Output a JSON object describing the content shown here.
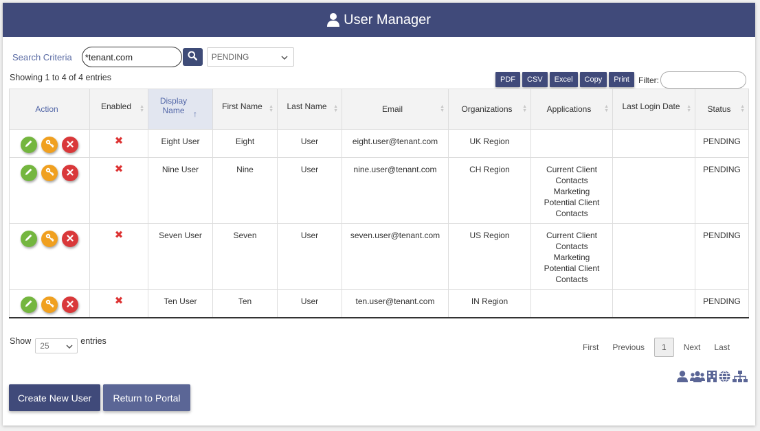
{
  "header": {
    "title": "User Manager",
    "icon": "user-icon"
  },
  "search": {
    "label": "Search Criteria",
    "value": "*tenant.com",
    "button_icon": "search-icon",
    "status_value": "PENDING"
  },
  "info": {
    "showing": "Showing 1 to 4 of 4 entries"
  },
  "export": {
    "pdf": "PDF",
    "csv": "CSV",
    "excel": "Excel",
    "copy": "Copy",
    "print": "Print"
  },
  "filter": {
    "label": "Filter:",
    "value": ""
  },
  "table": {
    "headers": {
      "action": "Action",
      "enabled": "Enabled",
      "display_name": "Display Name",
      "first_name": "First Name",
      "last_name": "Last Name",
      "email": "Email",
      "organizations": "Organizations",
      "applications": "Applications",
      "last_login": "Last Login Date",
      "status": "Status"
    },
    "rows": [
      {
        "enabled": "✖",
        "display_name": "Eight User",
        "first_name": "Eight",
        "last_name": "User",
        "email": "eight.user@tenant.com",
        "organizations": "UK Region",
        "applications": [],
        "last_login": "",
        "status": "PENDING"
      },
      {
        "enabled": "✖",
        "display_name": "Nine User",
        "first_name": "Nine",
        "last_name": "User",
        "email": "nine.user@tenant.com",
        "organizations": "CH Region",
        "applications": [
          "Current Client Contacts",
          "Marketing",
          "Potential Client Contacts"
        ],
        "last_login": "",
        "status": "PENDING"
      },
      {
        "enabled": "✖",
        "display_name": "Seven User",
        "first_name": "Seven",
        "last_name": "User",
        "email": "seven.user@tenant.com",
        "organizations": "US Region",
        "applications": [
          "Current Client Contacts",
          "Marketing",
          "Potential Client Contacts"
        ],
        "last_login": "",
        "status": "PENDING"
      },
      {
        "enabled": "✖",
        "display_name": "Ten User",
        "first_name": "Ten",
        "last_name": "User",
        "email": "ten.user@tenant.com",
        "organizations": "IN Region",
        "applications": [],
        "last_login": "",
        "status": "PENDING"
      }
    ]
  },
  "length": {
    "show": "Show",
    "value": "25",
    "entries": "entries"
  },
  "pagination": {
    "first": "First",
    "previous": "Previous",
    "current": "1",
    "next": "Next",
    "last": "Last"
  },
  "buttons": {
    "create": "Create New User",
    "portal": "Return to Portal"
  },
  "footer_icons": [
    "user-icon",
    "group-icon",
    "building-icon",
    "globe-icon",
    "sitemap-icon"
  ],
  "colors": {
    "primary": "#404a7a",
    "accent_text": "#5468a8",
    "edit": "#74b63f",
    "key": "#f0a020",
    "delete": "#d9383a"
  }
}
